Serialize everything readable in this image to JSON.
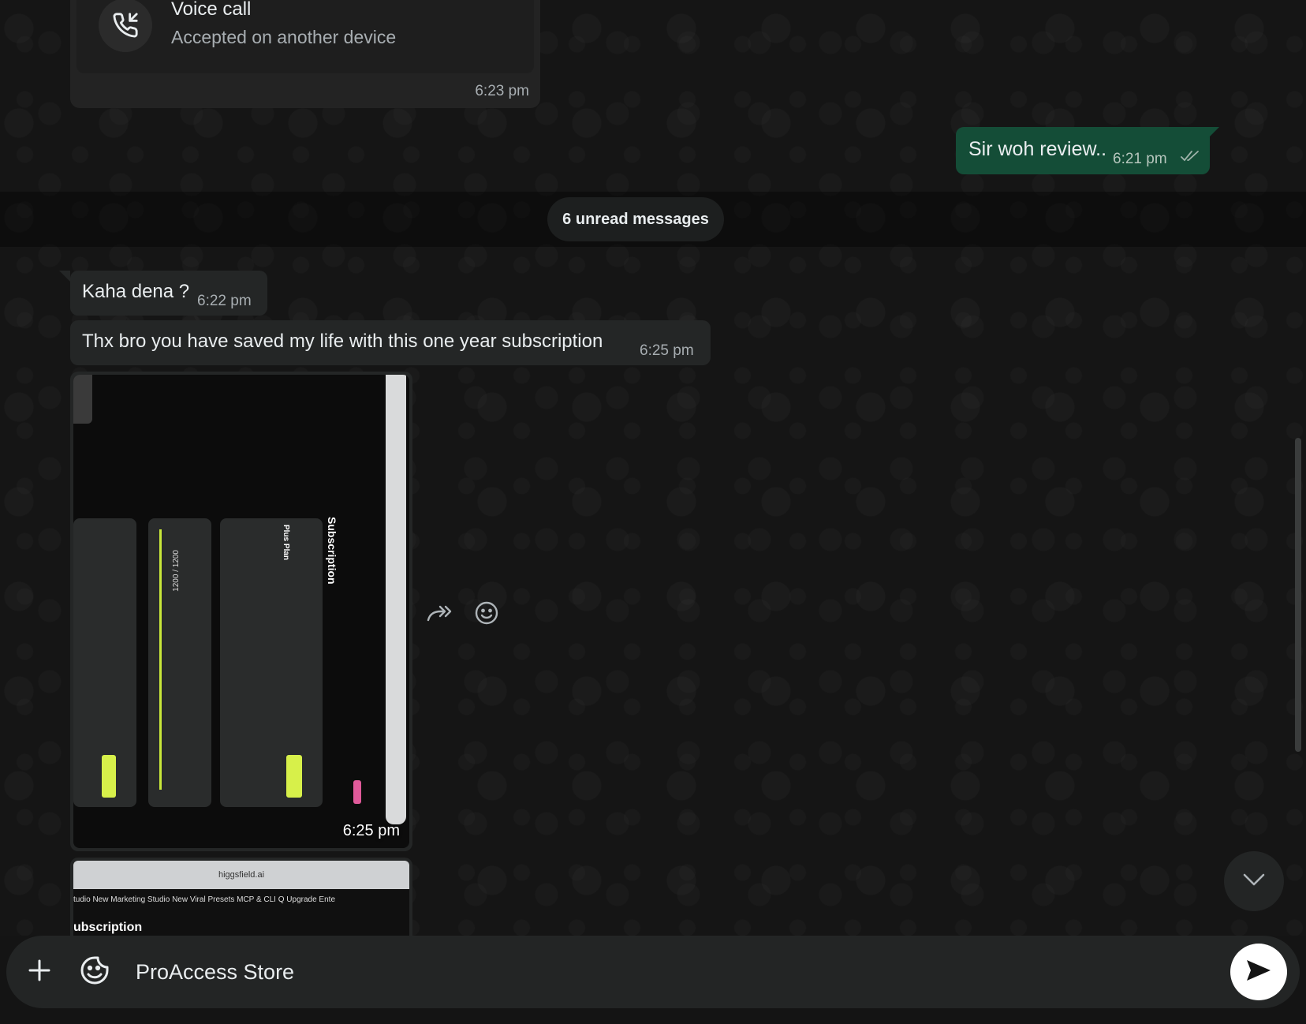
{
  "chat": {
    "voice_call": {
      "title": "Voice call",
      "status": "Accepted on another device",
      "time": "6:23 pm"
    },
    "outgoing": {
      "text": "Sir woh review..",
      "time": "6:21 pm"
    },
    "unread_label": "6 unread messages",
    "incoming": [
      {
        "text": "Kaha dena ?",
        "time": "6:22 pm"
      },
      {
        "text": "Thx bro you have saved my life with this one year subscription",
        "time": "6:25 pm"
      }
    ],
    "image_message": {
      "time": "6:25 pm",
      "screenshot_text": {
        "heading": "Subscription",
        "plan": "Plus Plan",
        "credits": "1200 / 1200"
      }
    },
    "image_message_2": {
      "url_bar": "higgsfield.ai",
      "nav": "tudio New   Marketing Studio New   Viral Presets   MCP & CLI   Q   Upgrade   Ente",
      "heading": "ubscription"
    }
  },
  "composer": {
    "value": "ProAccess Store"
  },
  "icons": {
    "call": "incoming-call-icon",
    "ticks": "double-check-icon",
    "forward": "forward-icon",
    "react": "emoji-react-icon",
    "scroll": "chevron-down-icon",
    "attach": "plus-icon",
    "sticker": "sticker-icon",
    "send": "send-icon"
  },
  "colors": {
    "outgoing_bubble": "#144d37",
    "incoming_bubble": "#242626",
    "background": "#151515"
  }
}
